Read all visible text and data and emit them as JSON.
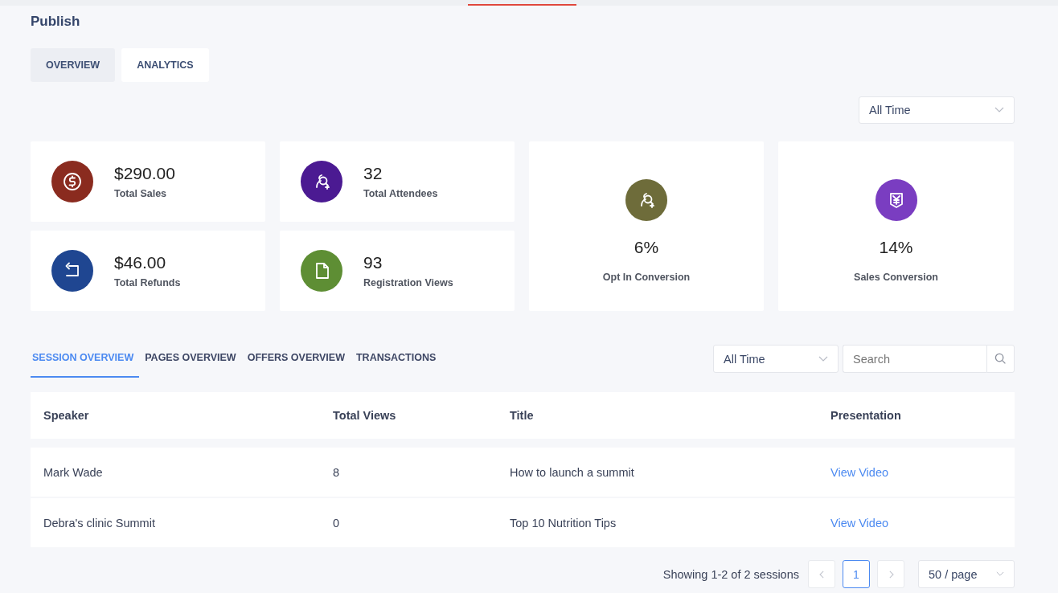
{
  "page_title": "Publish",
  "tabs": [
    {
      "label": "OVERVIEW",
      "selected": false
    },
    {
      "label": "ANALYTICS",
      "selected": true
    }
  ],
  "period_filter": {
    "value": "All Time"
  },
  "stats": [
    {
      "value": "$290.00",
      "label": "Total Sales",
      "color": "#8a2b1f"
    },
    {
      "value": "32",
      "label": "Total Attendees",
      "color": "#4b1a92"
    },
    {
      "value": "$46.00",
      "label": "Total Refunds",
      "color": "#1f4691"
    },
    {
      "value": "93",
      "label": "Registration Views",
      "color": "#5e8e34"
    }
  ],
  "conversions": [
    {
      "value": "6%",
      "label": "Opt In Conversion",
      "color": "#6e6c3a"
    },
    {
      "value": "14%",
      "label": "Sales Conversion",
      "color": "#7a3dc1"
    }
  ],
  "section_tabs": [
    {
      "label": "SESSION OVERVIEW",
      "selected": true
    },
    {
      "label": "PAGES OVERVIEW",
      "selected": false
    },
    {
      "label": "OFFERS OVERVIEW",
      "selected": false
    },
    {
      "label": "TRANSACTIONS",
      "selected": false
    }
  ],
  "table_filter": {
    "value": "All Time"
  },
  "search": {
    "placeholder": "Search"
  },
  "table": {
    "columns": [
      "Speaker",
      "Total Views",
      "Title",
      "Presentation"
    ],
    "rows": [
      [
        "Mark Wade",
        "8",
        "How to launch a summit",
        "View Video"
      ],
      [
        "Debra's clinic Summit",
        "0",
        "Top 10 Nutrition Tips",
        "View Video"
      ]
    ]
  },
  "pagination": {
    "summary": "Showing 1-2 of 2 sessions",
    "pages": [
      {
        "label": "1",
        "selected": true
      }
    ],
    "page_size": "50 / page"
  }
}
